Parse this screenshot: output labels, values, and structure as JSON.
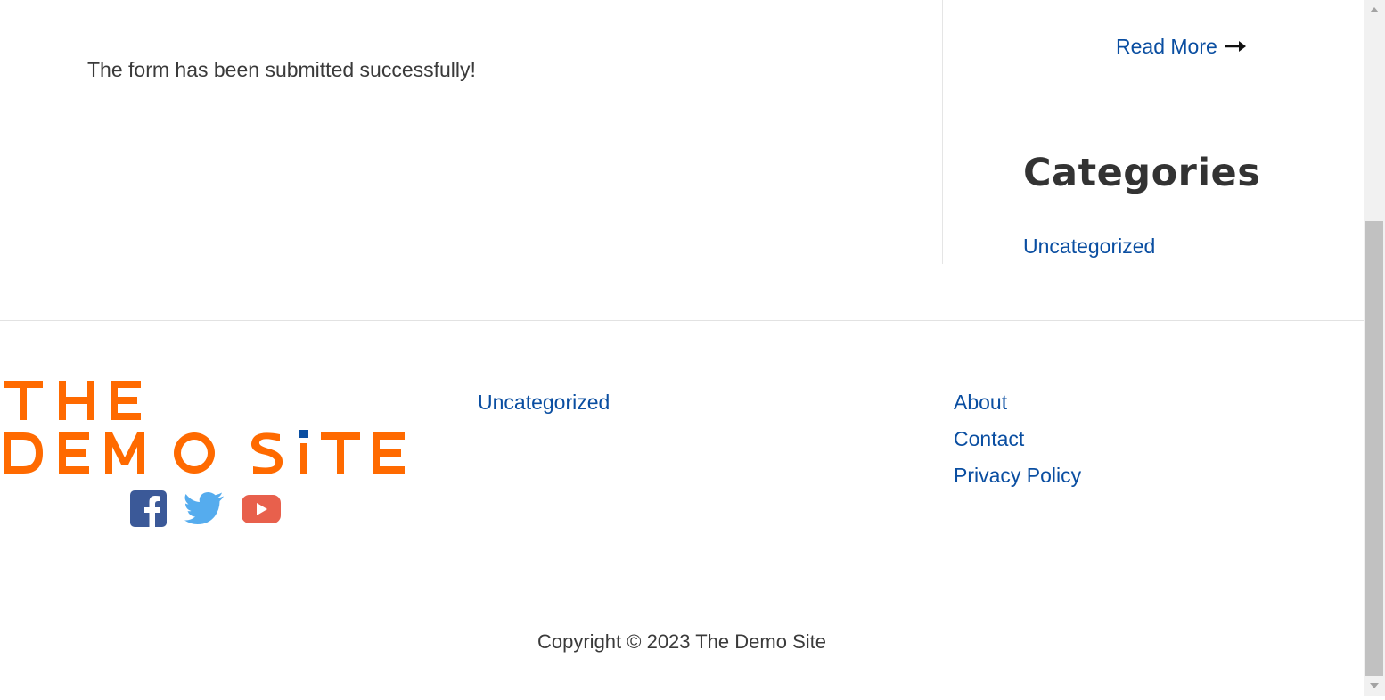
{
  "main": {
    "success_message": "The form has been submitted successfully!"
  },
  "sidebar": {
    "read_more_label": "Read More",
    "read_more_icon": "arrow-right-icon",
    "categories_heading": "Categories",
    "categories": [
      "Uncategorized"
    ]
  },
  "footer": {
    "logo": {
      "line1": "THE",
      "line2": "DEMO SiTE",
      "color": "#ff6a00",
      "accent": "#0a4ea1"
    },
    "social": [
      {
        "icon": "facebook-icon",
        "color": "#3b5998"
      },
      {
        "icon": "twitter-icon",
        "color": "#55acee"
      },
      {
        "icon": "youtube-icon",
        "color": "#e8604c"
      }
    ],
    "column2_links": [
      "Uncategorized"
    ],
    "column3_links": [
      "About",
      "Contact",
      "Privacy Policy"
    ],
    "copyright": "Copyright © 2023 The Demo Site"
  },
  "colors": {
    "link": "#0a4ea1",
    "text": "#3a3a3a",
    "heading": "#333333"
  }
}
